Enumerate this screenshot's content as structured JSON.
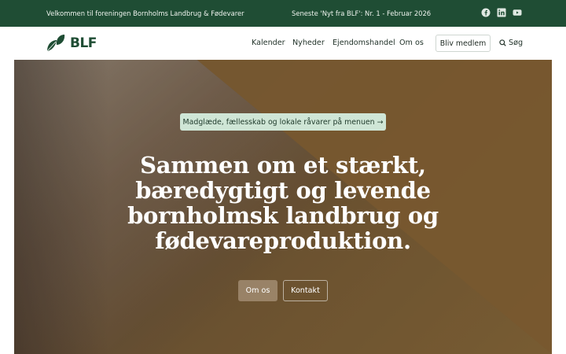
{
  "topbar": {
    "welcome": "Velkommen til foreningen Bornholms Landbrug & Fødevarer",
    "latest": "Seneste 'Nyt fra BLF': Nr. 1 - Februar 2026",
    "social": [
      "facebook-icon",
      "linkedin-icon",
      "youtube-icon"
    ],
    "bg_color": "#1f4d34"
  },
  "header": {
    "logo_text": "BLF",
    "nav": [
      "Kalender",
      "Nyheder",
      "Ejendomshandel",
      "Om os"
    ],
    "member_button": "Bliv medlem",
    "search_label": "Søg"
  },
  "hero": {
    "pill": "Madglæde, fællesskab og lokale råvarer på menuen →",
    "headline_lines": [
      "Sammen om et stærkt,",
      "bæredygtigt og levende",
      "bornholmsk landbrug og",
      "fødevareproduktion."
    ],
    "primary_button": "Om os",
    "secondary_button": "Kontakt"
  }
}
